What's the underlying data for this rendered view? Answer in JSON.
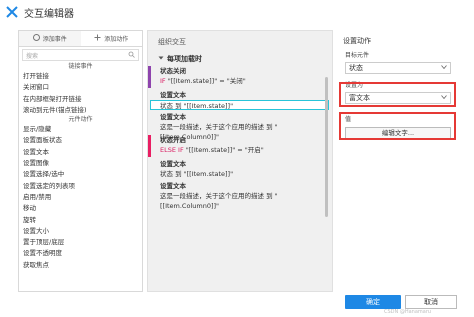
{
  "window": {
    "title": "交互编辑器"
  },
  "left_panel": {
    "tabs": [
      {
        "label": "添加事件",
        "icon": "event-icon"
      },
      {
        "label": "添加动作",
        "icon": "action-icon"
      }
    ],
    "search": {
      "placeholder": "搜索"
    },
    "link_group": "链接事件",
    "link_items": [
      "打开链接",
      "关闭窗口",
      "在内部框架打开链接",
      "滚动到元件(锚点链接)"
    ],
    "element_group": "元件动作",
    "element_items": [
      "显示/隐藏",
      "设置面板状态",
      "设置文本",
      "设置图像",
      "设置选择/选中",
      "设置选定的列表项",
      "启用/禁用",
      "移动",
      "旋转",
      "设置大小",
      "置于顶层/底层",
      "设置不透明度",
      "获取焦点"
    ]
  },
  "middle_panel": {
    "title": "组织交互",
    "event": "每项加载时",
    "cases": [
      {
        "name": "状态关闭",
        "condition_kw": "IF",
        "condition": "\"[[Item.state]]\" = \"关闭\"",
        "bar_color": "#8e44ad",
        "actions": [
          {
            "title": "设置文本",
            "desc": "状态 到 \"[[Item.state]]\"",
            "selected": true
          },
          {
            "title": "设置文本",
            "desc": "这是一段描述，关于这个应用的描述 到 \"[[Item.Column0]]\"",
            "selected": false
          }
        ]
      },
      {
        "name": "状态开启",
        "condition_kw": "ELSE IF",
        "condition": "\"[[Item.state]]\" = \"开启\"",
        "bar_color": "#e91e63",
        "actions": [
          {
            "title": "设置文本",
            "desc": "状态 到 \"[[Item.state]]\"",
            "selected": false
          },
          {
            "title": "设置文本",
            "desc": "这是一段描述，关于这个应用的描述 到 \"[[Item.Column0]]\"",
            "selected": false
          }
        ]
      }
    ]
  },
  "right_panel": {
    "title": "设置动作",
    "target_label": "目标元件",
    "target_value": "状态",
    "set_label": "设置为",
    "set_value": "富文本",
    "value_label": "值",
    "edit_button": "编辑文字..."
  },
  "footer": {
    "ok": "确定",
    "cancel": "取消",
    "watermark": "CSDN @Hanamaru"
  },
  "colors": {
    "accent": "#1e88e5",
    "highlight": "#e53935",
    "selection": "#27c4d9"
  }
}
